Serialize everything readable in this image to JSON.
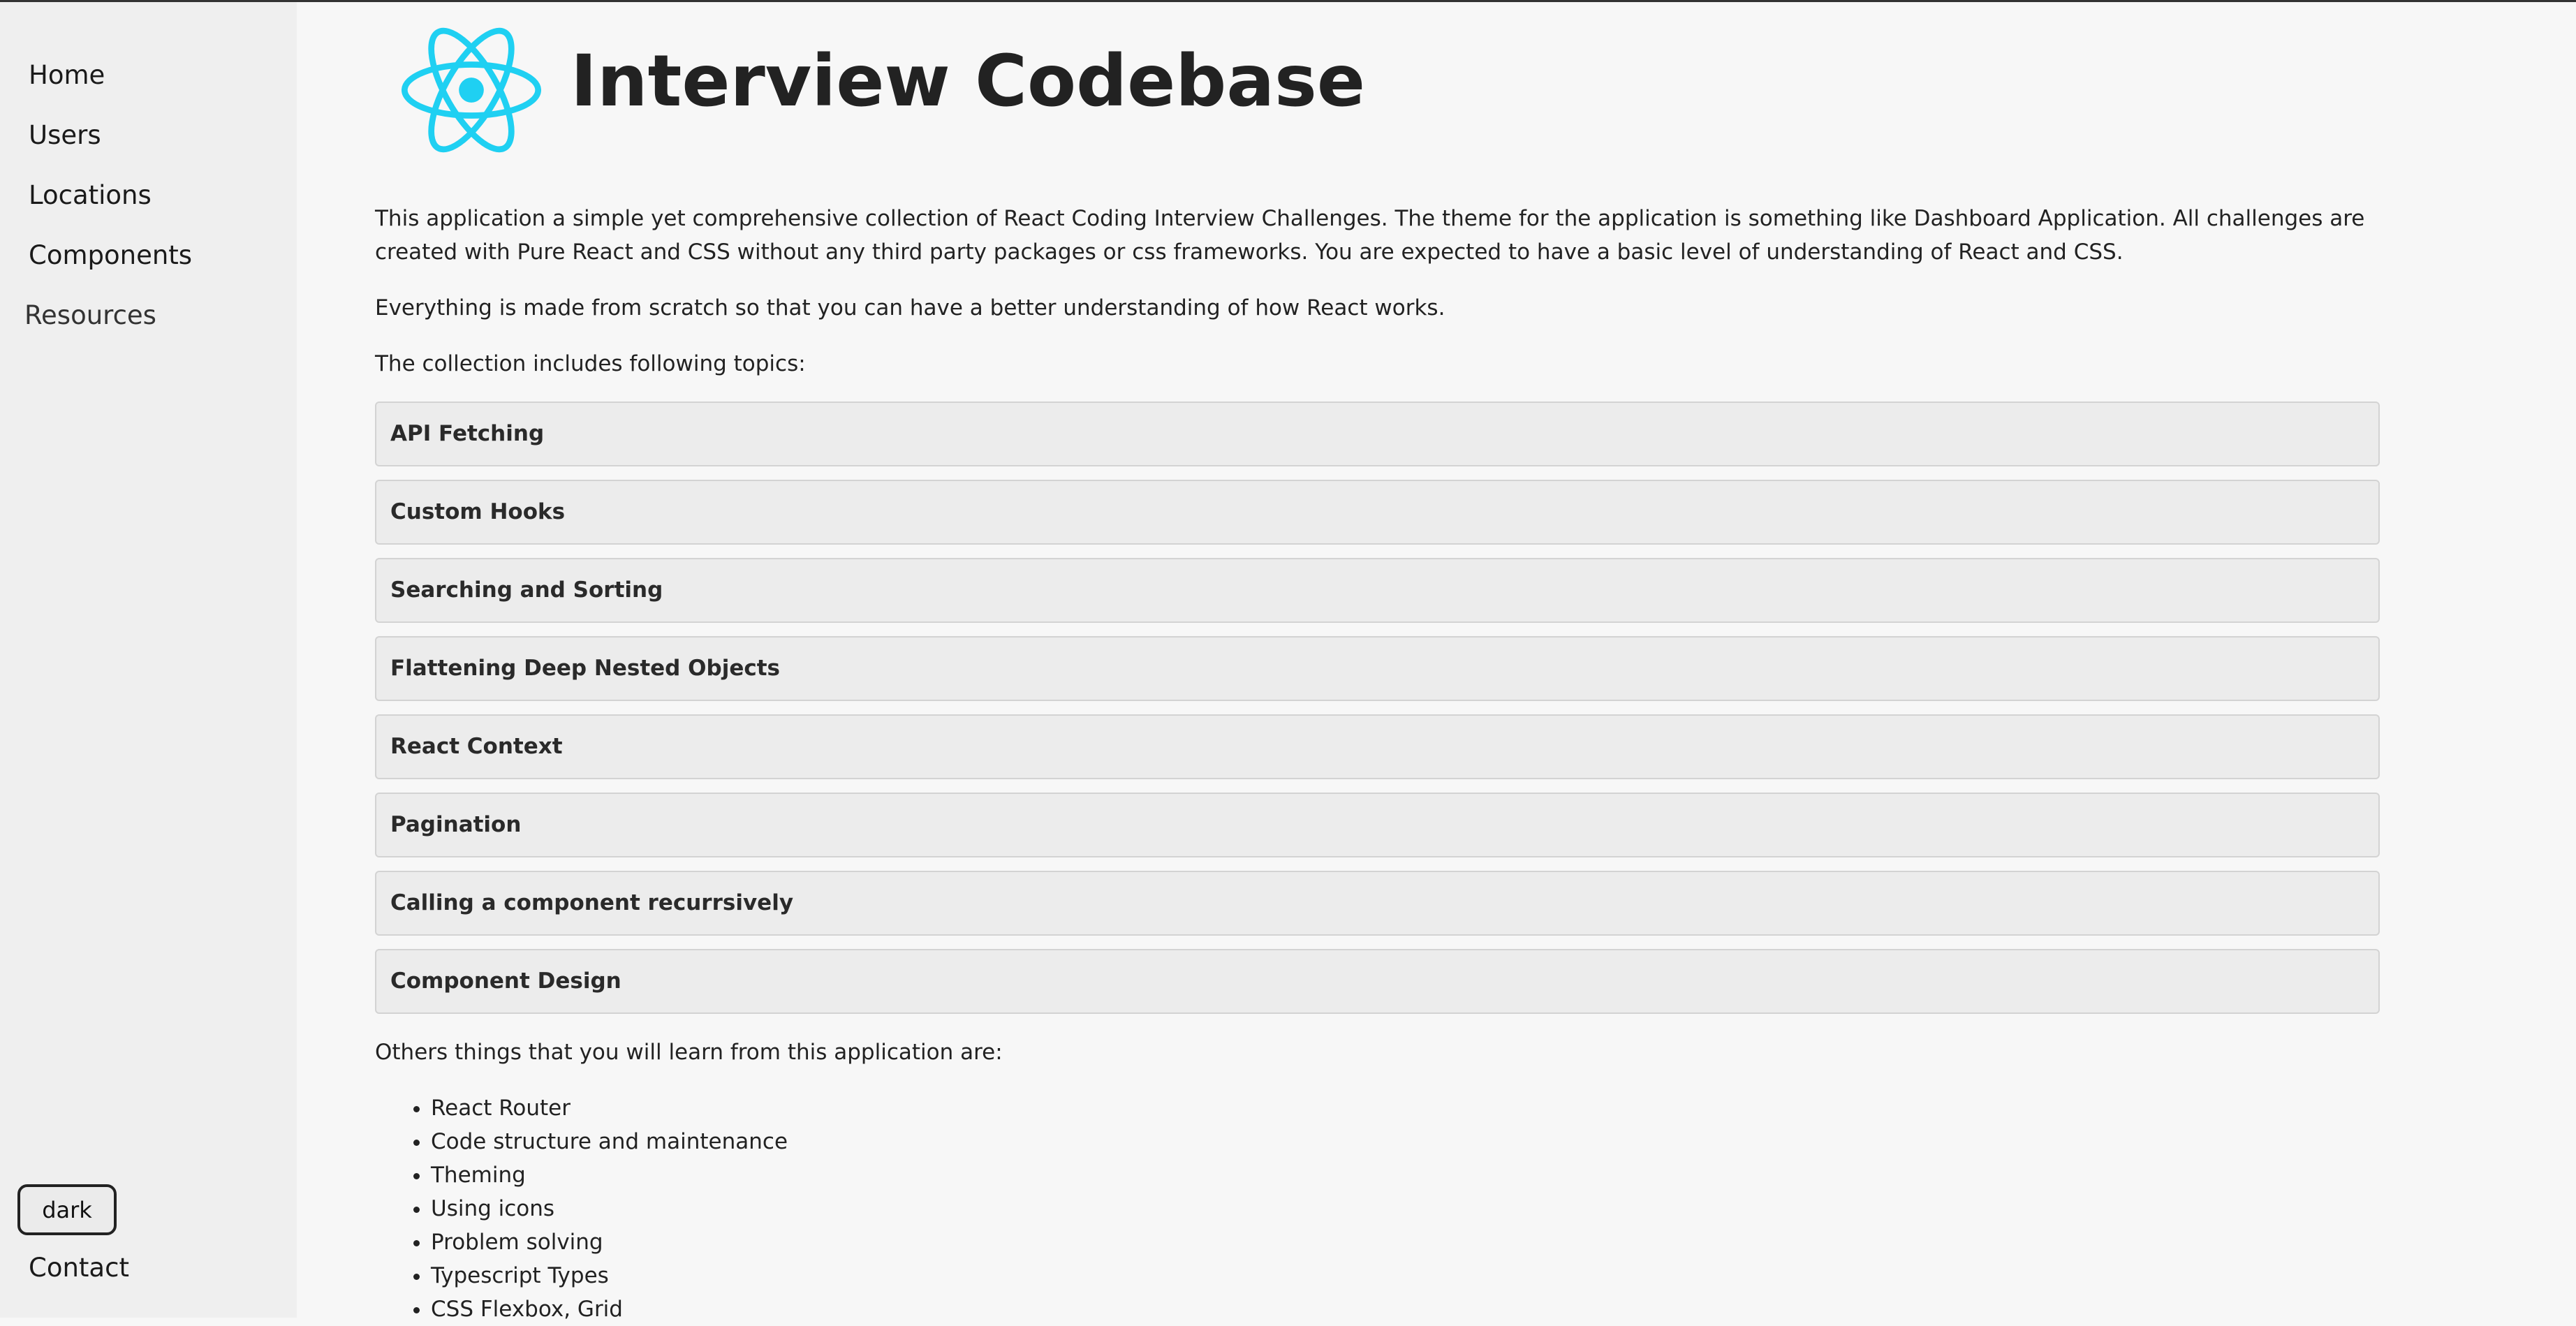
{
  "sidebar": {
    "items": [
      {
        "label": "Home"
      },
      {
        "label": "Users"
      },
      {
        "label": "Locations"
      },
      {
        "label": "Components"
      },
      {
        "label": "Resources"
      }
    ],
    "theme_toggle": "dark",
    "contact": "Contact"
  },
  "header": {
    "logo_icon": "react-atom-icon",
    "title": "Interview Codebase"
  },
  "intro": {
    "p1": "This application a simple yet comprehensive collection of React Coding Interview Challenges. The theme for the application is something like Dashboard Application. All challenges are created with Pure React and CSS without any third party packages or css frameworks. You are expected to have a basic level of understanding of React and CSS.",
    "p2": "Everything is made from scratch so that you can have a better understanding of how React works.",
    "p3": "The collection includes following topics:"
  },
  "topics": [
    "API Fetching",
    "Custom Hooks",
    "Searching and Sorting",
    "Flattening Deep Nested Objects",
    "React Context",
    "Pagination",
    "Calling a component recurrsively",
    "Component Design"
  ],
  "learn": {
    "heading": "Others things that you will learn from this application are:",
    "items": [
      "React Router",
      "Code structure and maintenance",
      "Theming",
      "Using icons",
      "Problem solving",
      "Typescript Types",
      "CSS Flexbox, Grid"
    ]
  },
  "colors": {
    "accent": "#1fd0f2",
    "sidebar_bg": "#efefef",
    "page_bg": "#f7f7f7"
  }
}
